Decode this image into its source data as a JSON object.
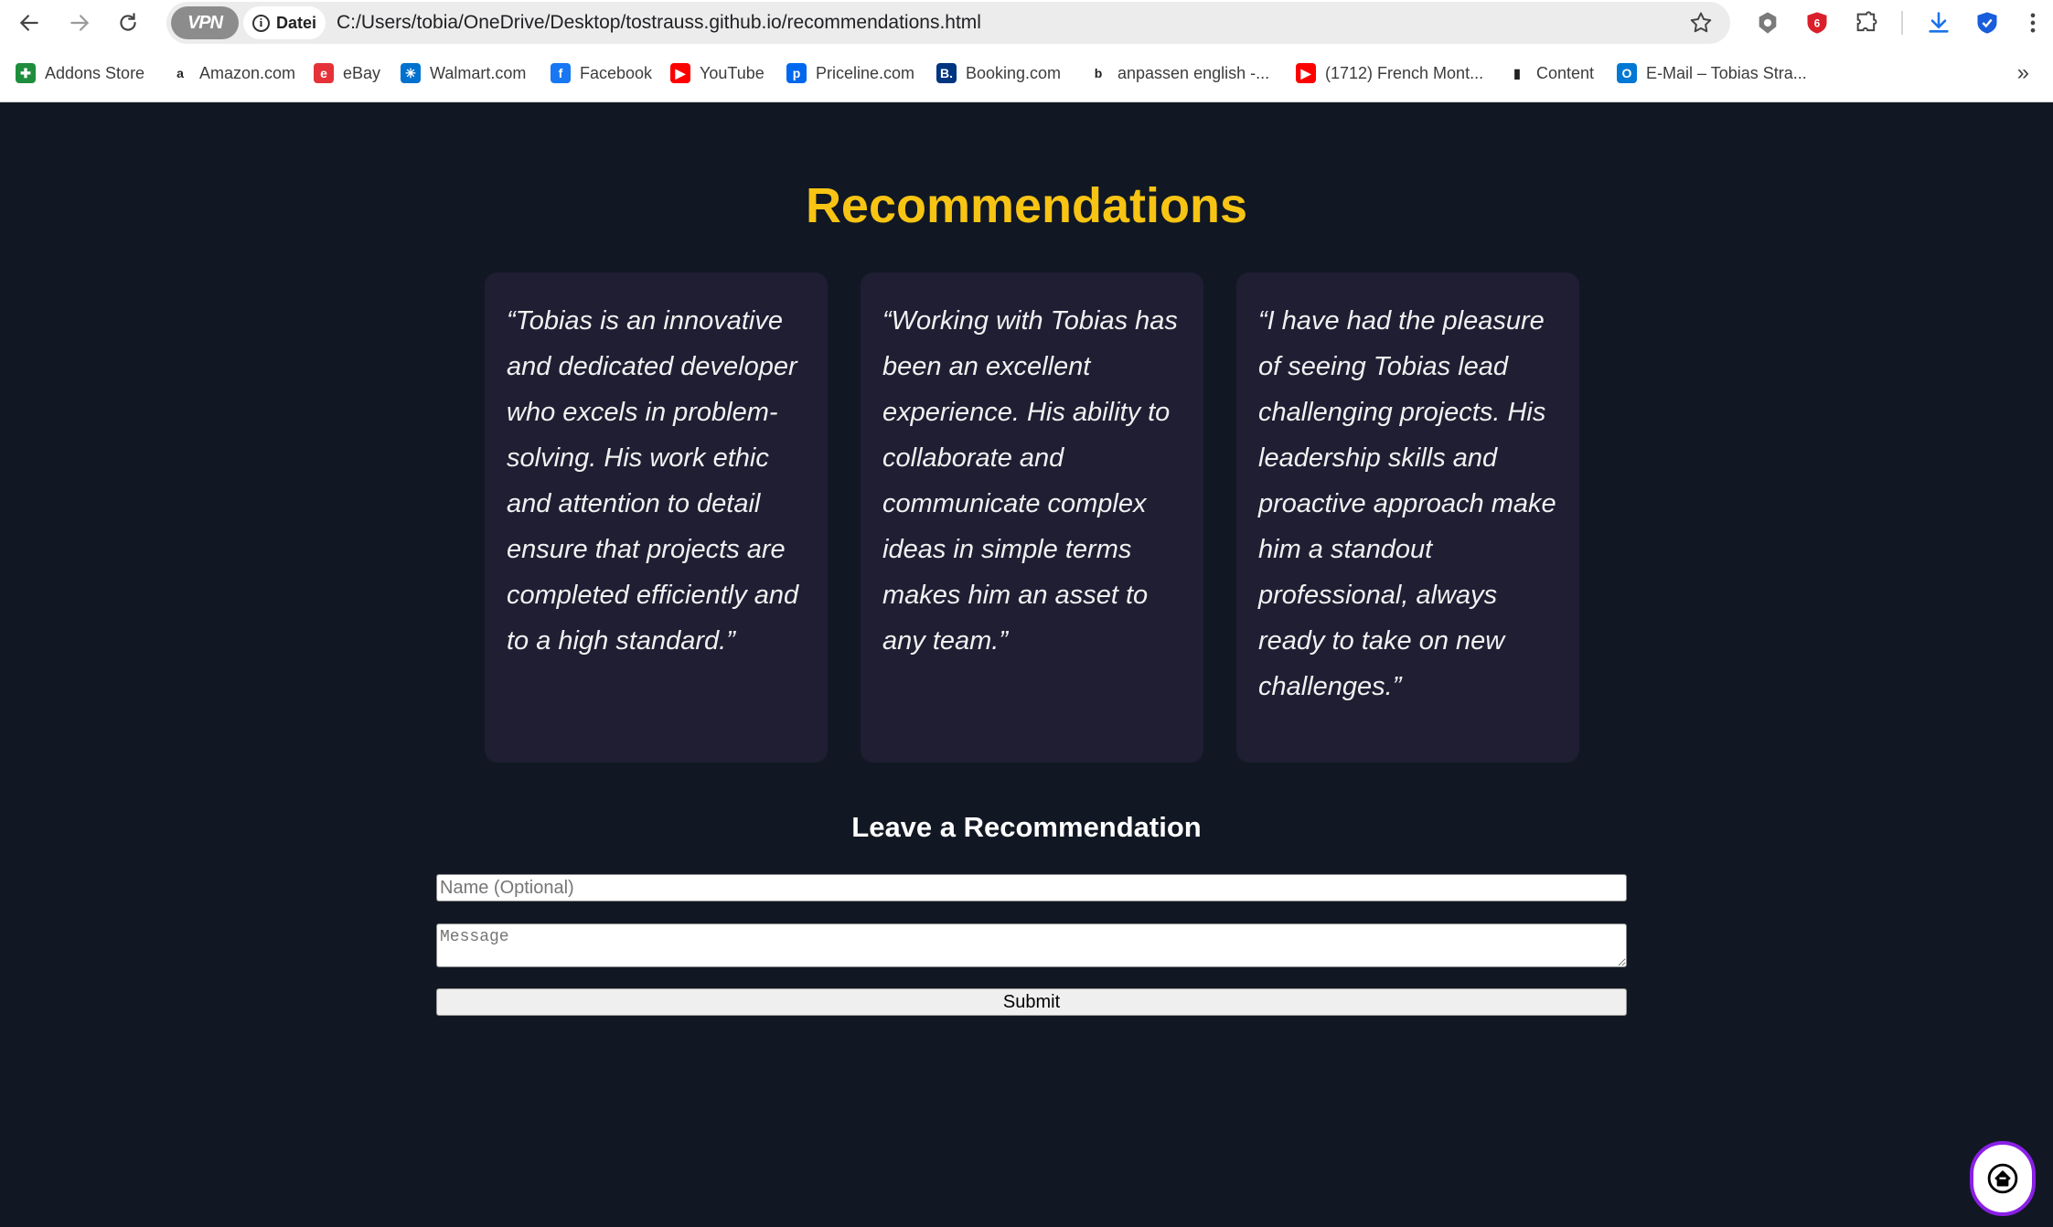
{
  "browser": {
    "vpn_label": "VPN",
    "file_chip_label": "Datei",
    "url": "C:/Users/tobia/OneDrive/Desktop/tostrauss.github.io/recommendations.html",
    "bookmarks": [
      {
        "label": "Addons Store",
        "icon": "addons-store-icon",
        "color": "#1e8e3e",
        "glyph": "✚"
      },
      {
        "label": "Amazon.com",
        "icon": "amazon-icon",
        "color": "#ffffff",
        "glyph": "a"
      },
      {
        "label": "eBay",
        "icon": "ebay-icon",
        "color": "#e53238",
        "glyph": "e"
      },
      {
        "label": "Walmart.com",
        "icon": "walmart-icon",
        "color": "#0071ce",
        "glyph": "✳"
      },
      {
        "label": "Facebook",
        "icon": "facebook-icon",
        "color": "#1877f2",
        "glyph": "f"
      },
      {
        "label": "YouTube",
        "icon": "youtube-icon",
        "color": "#ff0000",
        "glyph": "▶"
      },
      {
        "label": "Priceline.com",
        "icon": "priceline-icon",
        "color": "#0068ef",
        "glyph": "p"
      },
      {
        "label": "Booking.com",
        "icon": "booking-icon",
        "color": "#003580",
        "glyph": "B."
      },
      {
        "label": "anpassen english -...",
        "icon": "bing-icon",
        "color": "#ffffff",
        "glyph": "b"
      },
      {
        "label": "(1712) French Mont...",
        "icon": "youtube-icon",
        "color": "#ff0000",
        "glyph": "▶"
      },
      {
        "label": "Content",
        "icon": "chart-bars-icon",
        "color": "#ffffff",
        "glyph": "▮"
      },
      {
        "label": "E-Mail – Tobias Stra...",
        "icon": "outlook-icon",
        "color": "#0078d4",
        "glyph": "O"
      }
    ]
  },
  "page": {
    "title": "Recommendations",
    "recommendations": [
      {
        "quote": "“Tobias is an innovative and dedicated developer who excels in problem-solving. His work ethic and attention to detail ensure that projects are completed efficiently and to a high standard.”"
      },
      {
        "quote": "“Working with Tobias has been an excellent experience. His ability to collaborate and communicate complex ideas in simple terms makes him an asset to any team.”"
      },
      {
        "quote": "“I have had the pleasure of seeing Tobias lead challenging projects. His leadership skills and proactive approach make him a standout professional, always ready to take on new challenges.”"
      }
    ],
    "form": {
      "heading": "Leave a Recommendation",
      "name_placeholder": "Name (Optional)",
      "message_placeholder": "Message",
      "submit_label": "Submit"
    }
  },
  "colors": {
    "background": "#111823",
    "card": "#1f1e33",
    "title": "#f8c414",
    "home_button_border": "#8a20e6"
  }
}
